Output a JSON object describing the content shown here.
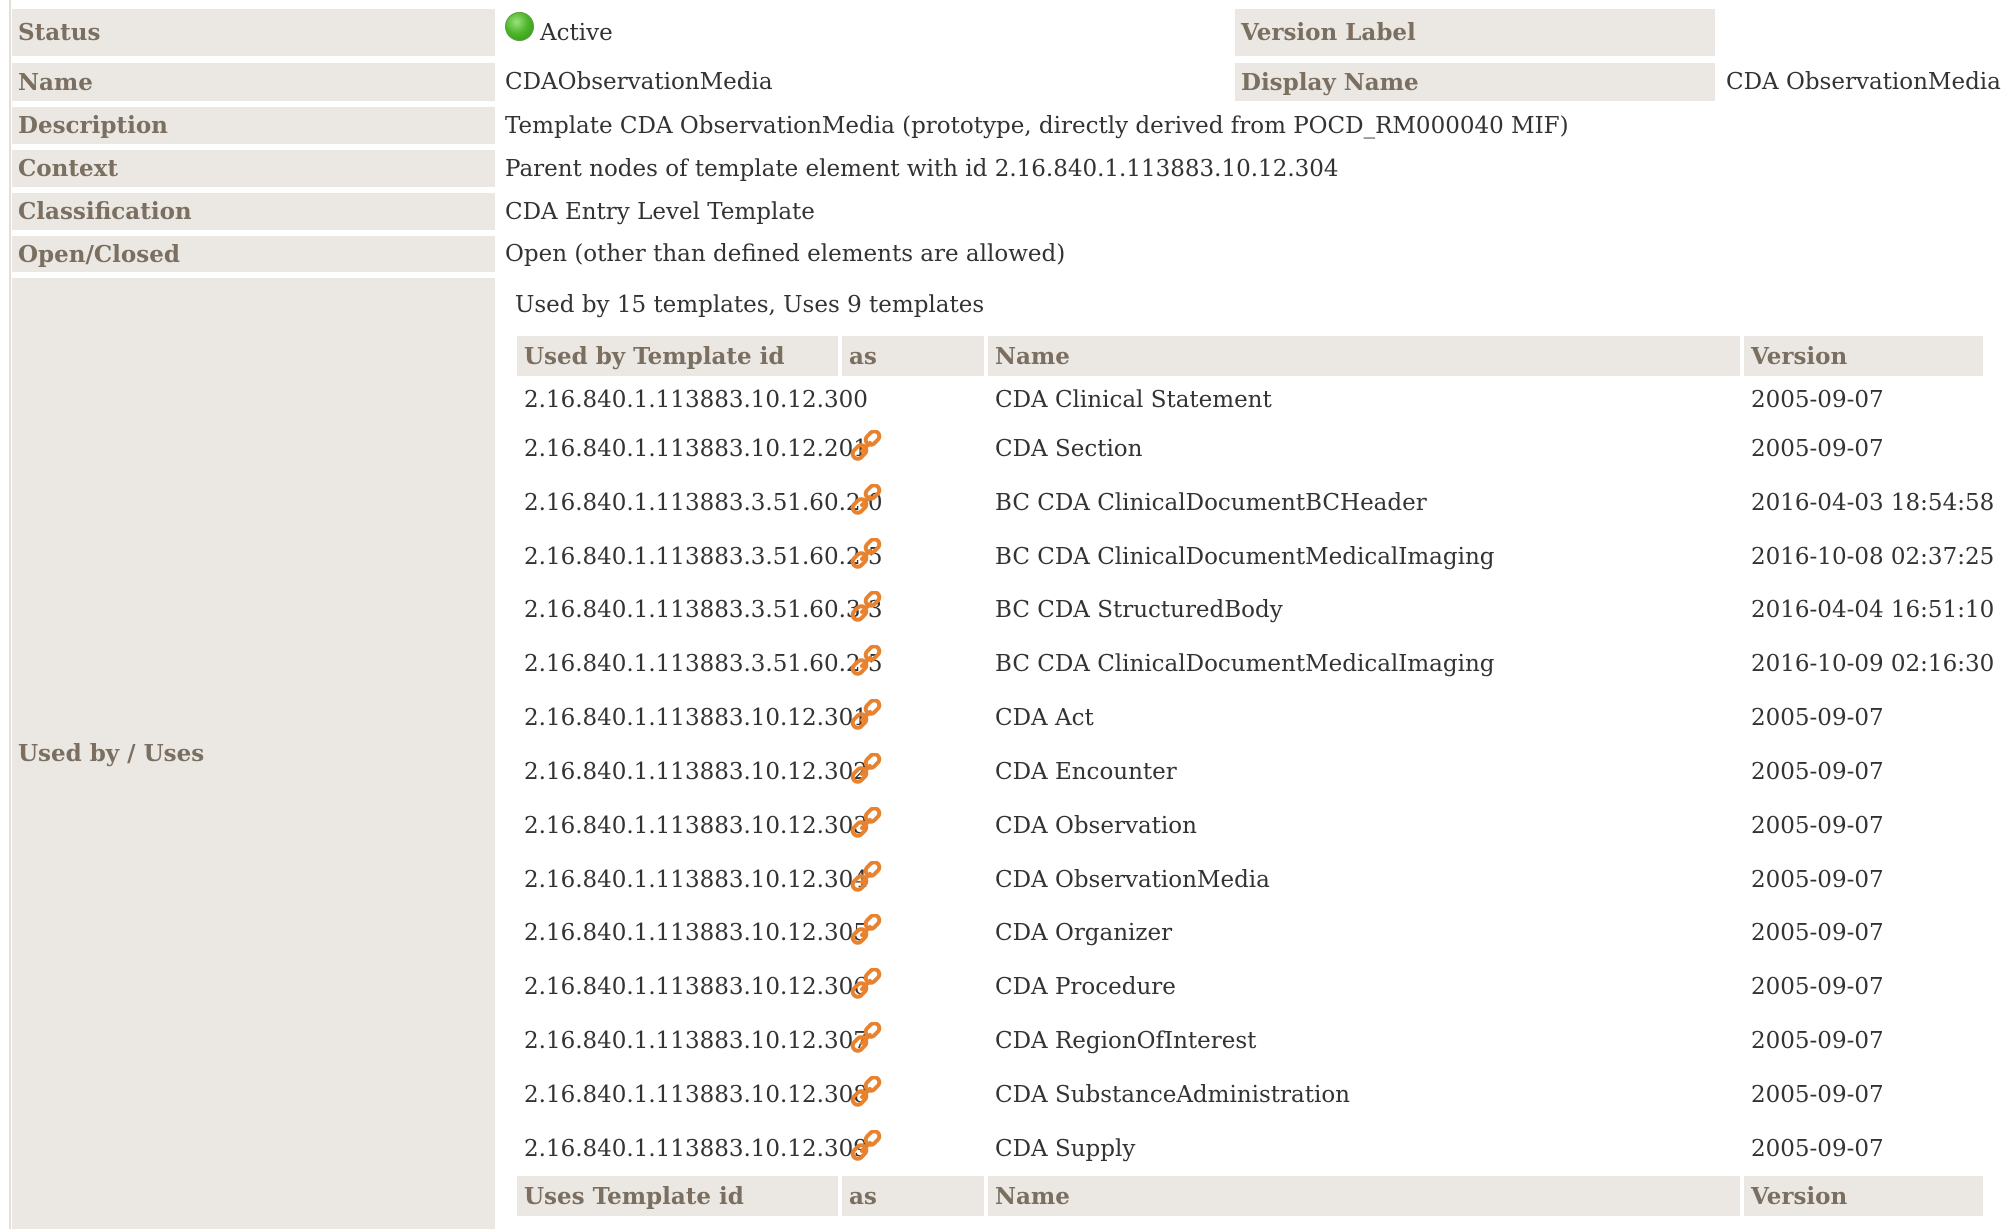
{
  "properties": {
    "status_label": "Status",
    "status_value": "Active",
    "version_label_label": "Version Label",
    "version_label_value": "",
    "name_label": "Name",
    "name_value": "CDAObservationMedia",
    "display_name_label": "Display Name",
    "display_name_value": "CDA ObservationMedia",
    "description_label": "Description",
    "description_value": "Template CDA ObservationMedia (prototype, directly derived from POCD_RM000040 MIF)",
    "context_label": "Context",
    "context_value": "Parent nodes of template element with id 2.16.840.1.113883.10.12.304",
    "classification_label": "Classification",
    "classification_value": "CDA Entry Level Template",
    "open_closed_label": "Open/Closed",
    "open_closed_value": "Open (other than defined elements are allowed)",
    "used_by_uses_label": "Used by / Uses"
  },
  "usage": {
    "summary": "Used by 15 templates, Uses 9 templates",
    "used_by_headers": [
      "Used by Template id",
      "as",
      "Name",
      "Version"
    ],
    "used_by_rows": [
      {
        "id": "2.16.840.1.113883.10.12.300",
        "link": false,
        "name": "CDA Clinical Statement",
        "version": "2005-09-07"
      },
      {
        "id": "2.16.840.1.113883.10.12.201",
        "link": true,
        "name": "CDA Section",
        "version": "2005-09-07"
      },
      {
        "id": "2.16.840.1.113883.3.51.60.2.0",
        "link": true,
        "name": "BC CDA ClinicalDocumentBCHeader",
        "version": "2016-04-03 18:54:58"
      },
      {
        "id": "2.16.840.1.113883.3.51.60.2.5",
        "link": true,
        "name": "BC CDA ClinicalDocumentMedicalImaging",
        "version": "2016-10-08 02:37:25"
      },
      {
        "id": "2.16.840.1.113883.3.51.60.3.3",
        "link": true,
        "name": "BC CDA StructuredBody",
        "version": "2016-04-04 16:51:10"
      },
      {
        "id": "2.16.840.1.113883.3.51.60.2.5",
        "link": true,
        "name": "BC CDA ClinicalDocumentMedicalImaging",
        "version": "2016-10-09 02:16:30"
      },
      {
        "id": "2.16.840.1.113883.10.12.301",
        "link": true,
        "name": "CDA Act",
        "version": "2005-09-07"
      },
      {
        "id": "2.16.840.1.113883.10.12.302",
        "link": true,
        "name": "CDA Encounter",
        "version": "2005-09-07"
      },
      {
        "id": "2.16.840.1.113883.10.12.303",
        "link": true,
        "name": "CDA Observation",
        "version": "2005-09-07"
      },
      {
        "id": "2.16.840.1.113883.10.12.304",
        "link": true,
        "name": "CDA ObservationMedia",
        "version": "2005-09-07"
      },
      {
        "id": "2.16.840.1.113883.10.12.305",
        "link": true,
        "name": "CDA Organizer",
        "version": "2005-09-07"
      },
      {
        "id": "2.16.840.1.113883.10.12.306",
        "link": true,
        "name": "CDA Procedure",
        "version": "2005-09-07"
      },
      {
        "id": "2.16.840.1.113883.10.12.307",
        "link": true,
        "name": "CDA RegionOfInterest",
        "version": "2005-09-07"
      },
      {
        "id": "2.16.840.1.113883.10.12.308",
        "link": true,
        "name": "CDA SubstanceAdministration",
        "version": "2005-09-07"
      },
      {
        "id": "2.16.840.1.113883.10.12.309",
        "link": true,
        "name": "CDA Supply",
        "version": "2005-09-07"
      }
    ],
    "uses_headers": [
      "Uses Template id",
      "as",
      "Name",
      "Version"
    ]
  },
  "colors": {
    "label_bg": "#ebe8e3",
    "label_text": "#7a6f61",
    "link_icon": "#e8822e",
    "status_active": "#4cb52a"
  },
  "icons": {
    "status": "green-dot-icon",
    "link": "chain-link-icon"
  }
}
